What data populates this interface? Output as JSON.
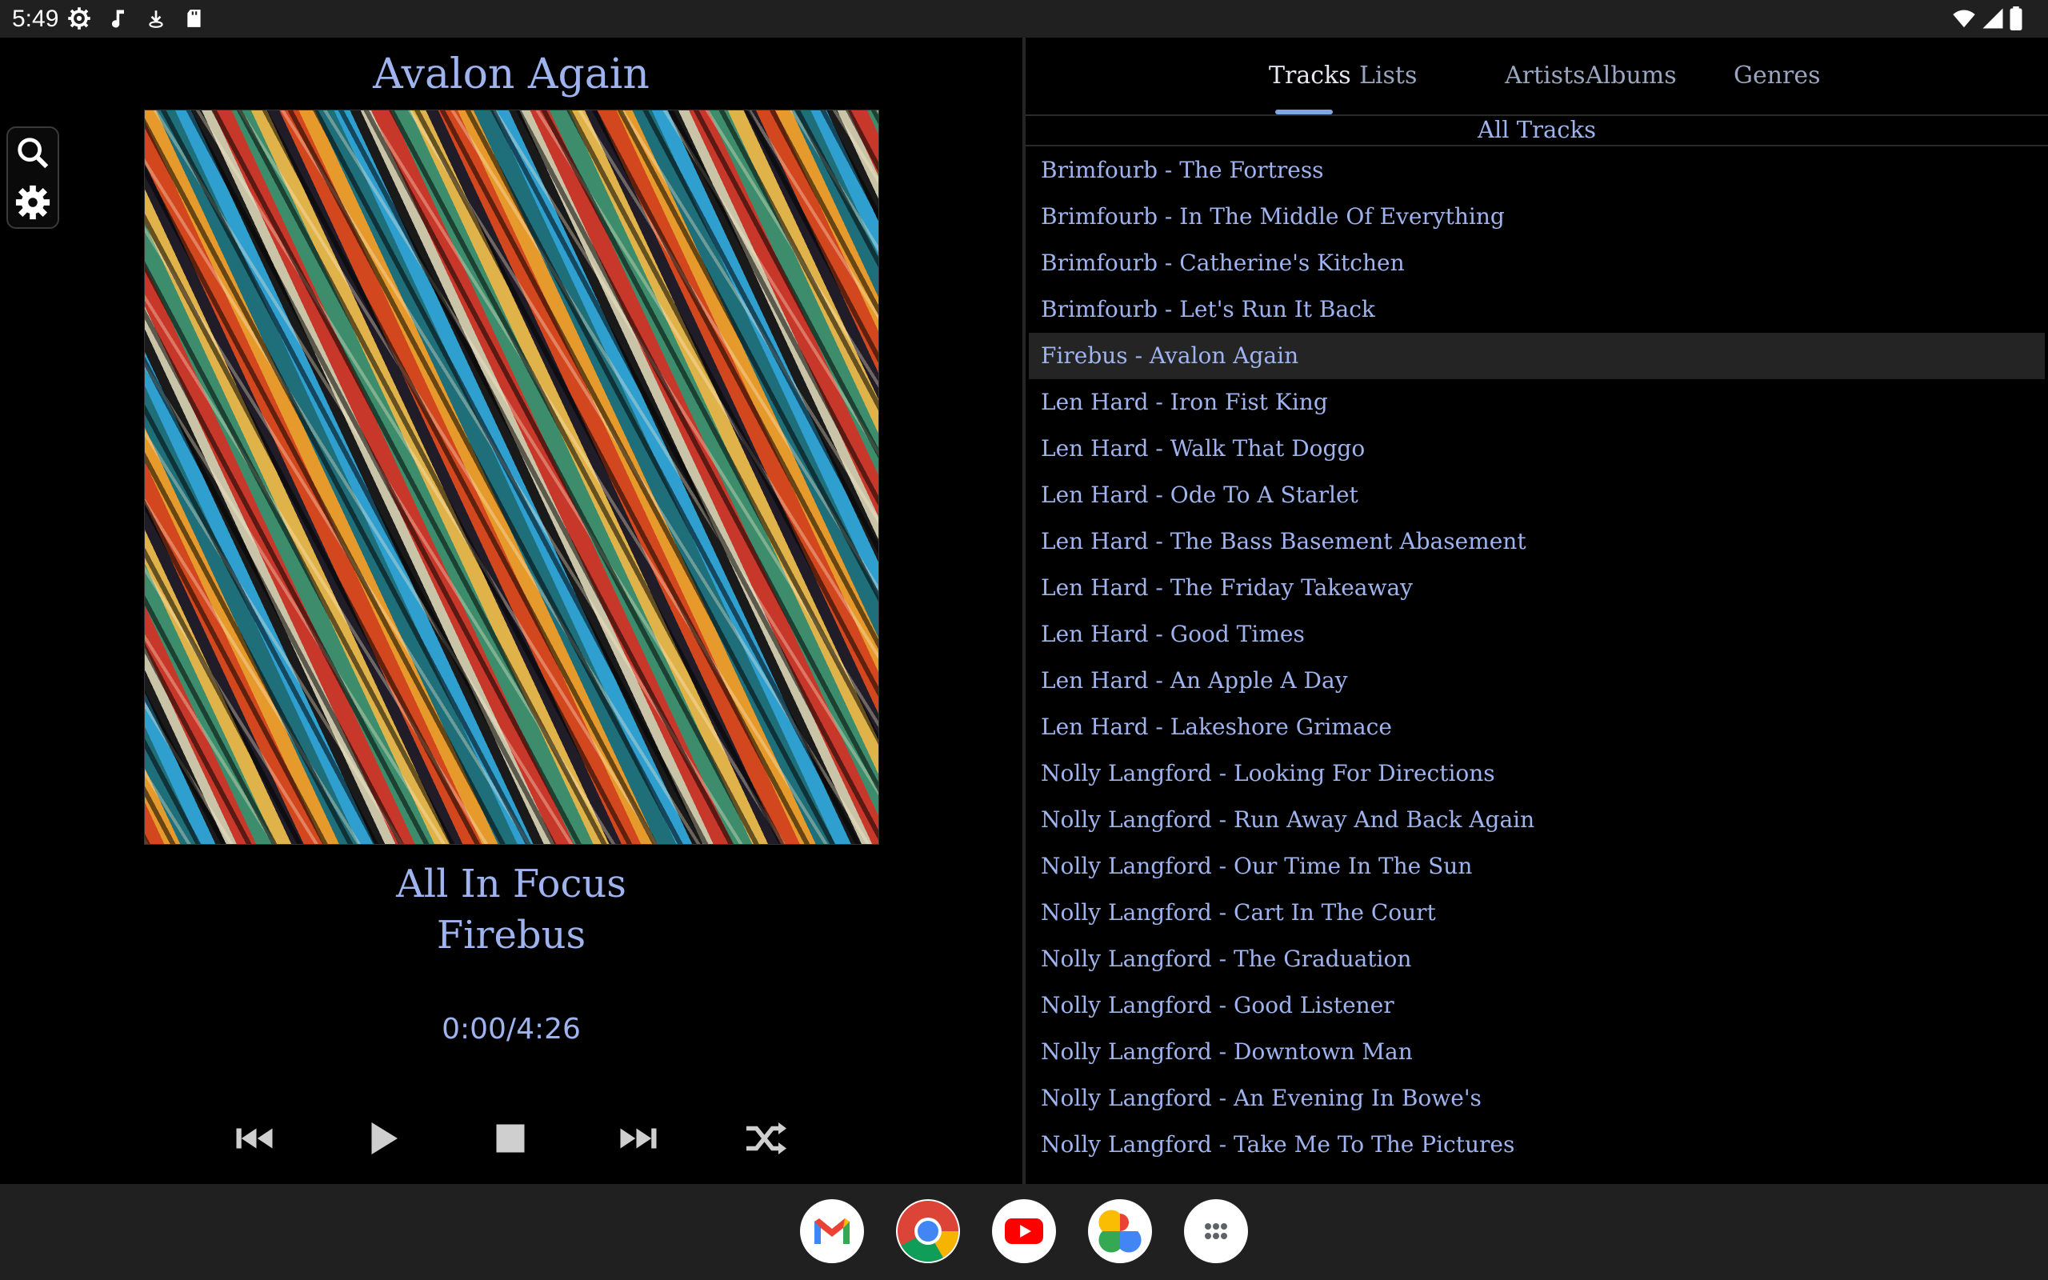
{
  "status_bar": {
    "time": "5:49",
    "left_icons": [
      "settings-gear-icon",
      "music-note-icon",
      "download-icon",
      "sd-card-icon"
    ],
    "right_icons": [
      "wifi-icon",
      "signal-icon",
      "battery-icon"
    ]
  },
  "player": {
    "song_title": "Avalon Again",
    "album": "All In Focus",
    "artist": "Firebus",
    "time_display": "0:00/4:26",
    "tools": [
      "search-icon",
      "settings-icon"
    ],
    "controls": [
      "previous-icon",
      "play-icon",
      "stop-icon",
      "next-icon",
      "shuffle-icon"
    ]
  },
  "library": {
    "tabs": [
      {
        "label": "Tracks",
        "active": true
      },
      {
        "label": "Lists",
        "active": false
      },
      {
        "label": "Artists",
        "active": false
      },
      {
        "label": "Albums",
        "active": false
      },
      {
        "label": "Genres",
        "active": false
      }
    ],
    "list_header": "All Tracks",
    "tracks": [
      "Brimfourb - The Fortress",
      "Brimfourb - In The Middle Of Everything",
      "Brimfourb - Catherine's Kitchen",
      "Brimfourb - Let's Run It Back",
      "Firebus - Avalon Again",
      "Len Hard - Iron Fist King",
      "Len Hard - Walk That Doggo",
      "Len Hard - Ode To A Starlet",
      "Len Hard - The Bass Basement Abasement",
      "Len Hard - The Friday Takeaway",
      "Len Hard - Good Times",
      "Len Hard - An Apple A Day",
      "Len Hard - Lakeshore Grimace",
      "Nolly Langford - Looking For Directions",
      "Nolly Langford - Run Away And Back Again",
      "Nolly Langford - Our Time In The Sun",
      "Nolly Langford - Cart In The Court",
      "Nolly Langford - The Graduation",
      "Nolly Langford - Good Listener",
      "Nolly Langford - Downtown Man",
      "Nolly Langford - An Evening In Bowe's",
      "Nolly Langford - Take Me To The Pictures"
    ],
    "selected_track": "Firebus - Avalon Again"
  },
  "taskbar": {
    "apps": [
      "gmail-icon",
      "chrome-icon",
      "youtube-icon",
      "photos-icon",
      "app-drawer-icon"
    ]
  },
  "colors": {
    "accent_text": "#9fb4ee",
    "selected_row": "#242424",
    "tab_indicator": "#7fa7e6"
  }
}
